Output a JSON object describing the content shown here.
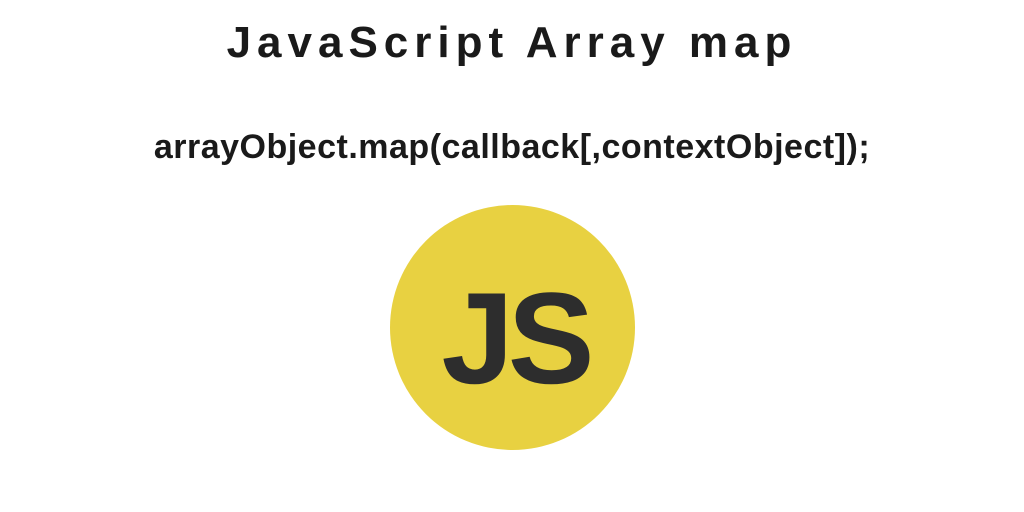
{
  "title": "JavaScript Array map",
  "code": "arrayObject.map(callback[,contextObject]);",
  "logo": {
    "text": "JS",
    "bg_color": "#e8d141",
    "text_color": "#2d2d2d"
  }
}
